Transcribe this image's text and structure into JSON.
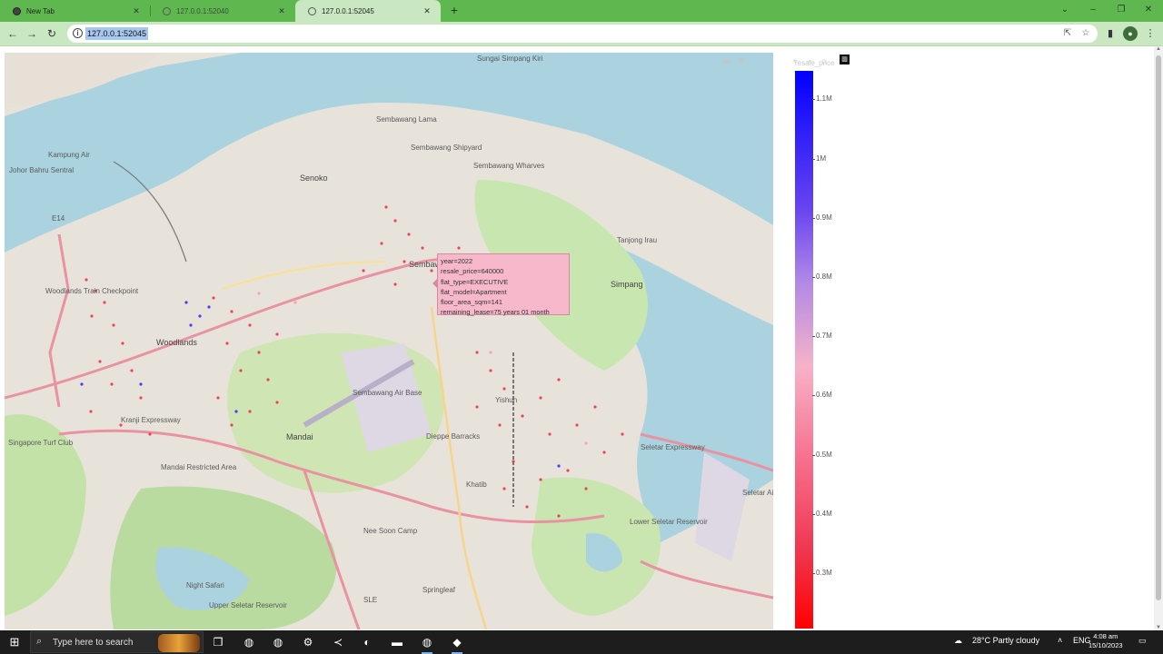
{
  "browser": {
    "tabs": [
      {
        "title": "New Tab",
        "active": false
      },
      {
        "title": "127.0.0.1:52040",
        "active": false
      },
      {
        "title": "127.0.0.1:52045",
        "active": true
      }
    ],
    "url": "127.0.0.1:52045",
    "accent_color": "#5fb84f",
    "toolbar_color": "#c9e8c1"
  },
  "map": {
    "place_labels": [
      "Sembawang Lama",
      "Sembawang Shipyard",
      "Sembawang Wharves",
      "Senoko",
      "Sembawang",
      "Simpang",
      "Tanjong Irau",
      "Woodlands",
      "Woodlands Train Checkpoint",
      "Mandai",
      "Sembawang Air Base",
      "Dieppe Barracks",
      "Khatib",
      "Nee Soon Camp",
      "Springleaf",
      "Night Safari",
      "Upper Seletar Reservoir",
      "Lower Seletar Reservoir",
      "Seletar Airport",
      "Johor Bahru Sentral",
      "Kampung Air",
      "Singapore Turf Club",
      "Mandai Restricted Area",
      "Sungai Simpang Kiri",
      "Yishun",
      "SLE",
      "E14",
      "Kranji Expressway",
      "Seletar Expressway"
    ]
  },
  "hover_tooltip": {
    "lines": [
      "year=2022",
      "resale_price=640000",
      "flat_type=EXECUTIVE",
      "flat_model=Apartment",
      "floor_area_sqm=141",
      "remaining_lease=75 years 01 month"
    ]
  },
  "colorbar": {
    "title": "resale_price",
    "ticks": [
      "1.1M",
      "1M",
      "0.9M",
      "0.8M",
      "0.7M",
      "0.6M",
      "0.5M",
      "0.4M",
      "0.3M"
    ],
    "low_color": "#ff0000",
    "mid_color": "#f7b2c8",
    "high_color": "#0000ff"
  },
  "taskbar": {
    "search_placeholder": "Type here to search",
    "weather": "28°C  Partly cloudy",
    "language": "ENG",
    "time": "4:08 am",
    "date": "15/10/2023",
    "pinned_icons": [
      "task-view-icon",
      "chrome-icon",
      "chrome-icon",
      "settings-icon",
      "vscode-icon",
      "github-icon",
      "file-explorer-icon",
      "chrome-icon",
      "python-icon"
    ]
  }
}
